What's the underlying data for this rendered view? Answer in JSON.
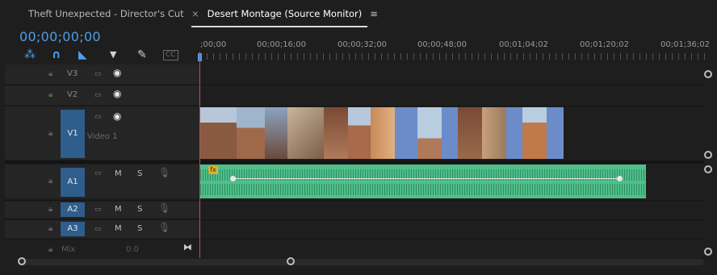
{
  "tabs": {
    "inactive_label": "Theft Unexpected - Director's Cut",
    "active_close": "×",
    "active_label": "Desert Montage (Source Monitor)",
    "active_menu": "≡"
  },
  "timecode": "00;00;00;00",
  "toolbar": {
    "snap_icon": "snap-icon",
    "linked_icon": "linked-selection-icon",
    "marker_add_icon": "add-marker-icon",
    "marker_icon": "marker-icon",
    "settings_icon": "wrench-icon",
    "captions_icon": "captions-icon"
  },
  "ruler": {
    "ticks": [
      ";00;00",
      "00;00;16;00",
      "00;00;32;00",
      "00;00;48;00",
      "00;01;04;02",
      "00;01;20;02",
      "00;01;36;02"
    ]
  },
  "tracks": {
    "v3": {
      "label": "V3"
    },
    "v2": {
      "label": "V2"
    },
    "v1": {
      "label": "V1",
      "name": "Video 1"
    },
    "a1": {
      "label": "A1",
      "mute": "M",
      "solo": "S"
    },
    "a2": {
      "label": "A2",
      "mute": "M",
      "solo": "S"
    },
    "a3": {
      "label": "A3",
      "mute": "M",
      "solo": "S"
    },
    "mix": {
      "label": "Mix",
      "value": "0.0"
    }
  },
  "colors": {
    "accent": "#4f9de8",
    "audio_clip": "#4fbf8c",
    "video_clip": "#6b8cc8",
    "playhead": "#c05050"
  },
  "clip_fx_badge": "fx"
}
